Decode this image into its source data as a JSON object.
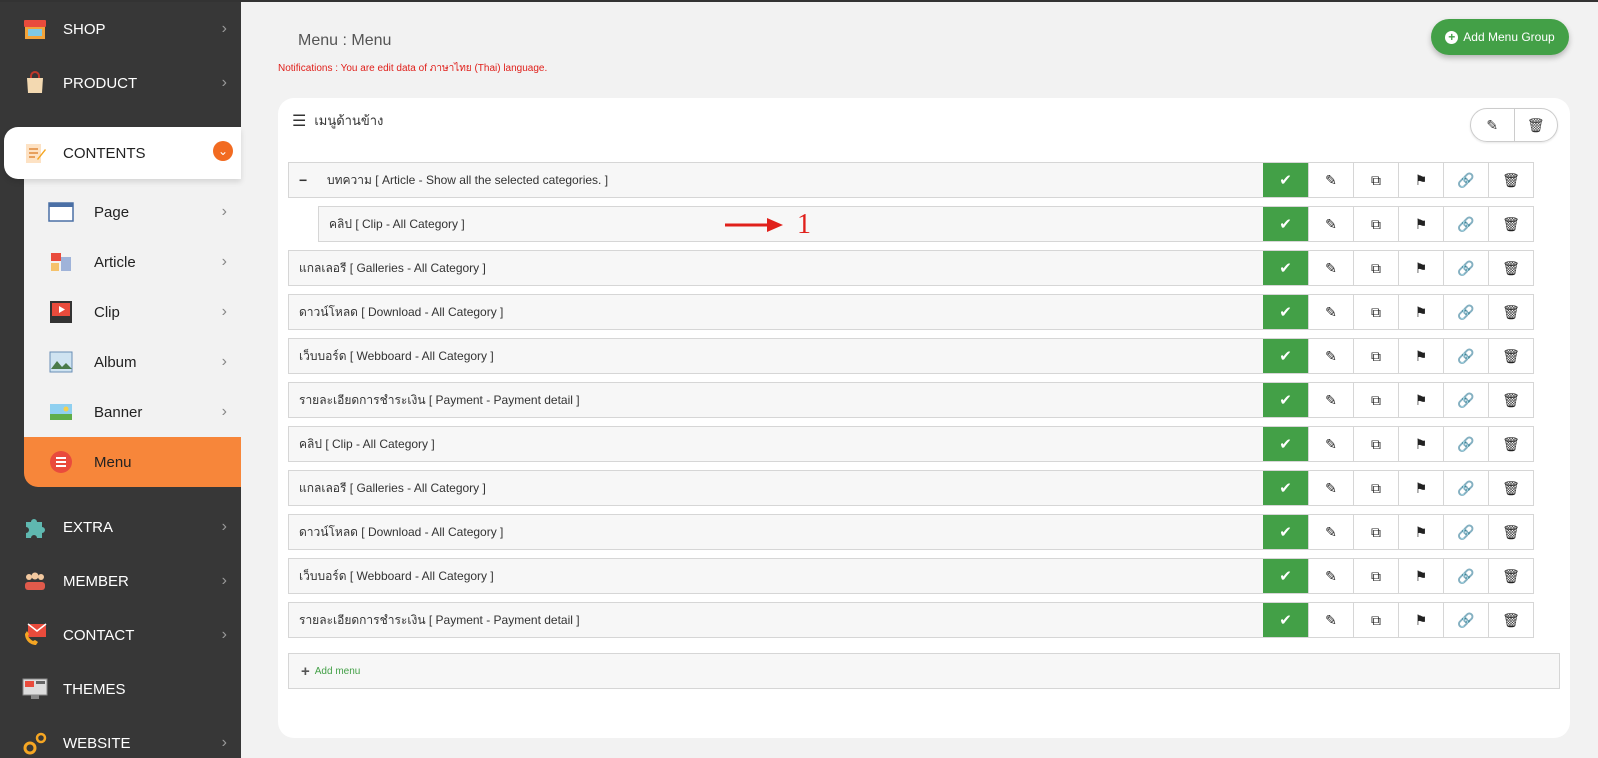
{
  "sidebar": {
    "top_items": [
      {
        "label": "SHOP",
        "icon": "shop-icon"
      },
      {
        "label": "PRODUCT",
        "icon": "product-bag-icon"
      }
    ],
    "contents": {
      "label": "CONTENTS",
      "icon": "contents-edit-icon",
      "sub_items": [
        {
          "label": "Page",
          "icon": "page-icon"
        },
        {
          "label": "Article",
          "icon": "article-icon"
        },
        {
          "label": "Clip",
          "icon": "clip-icon"
        },
        {
          "label": "Album",
          "icon": "album-icon"
        },
        {
          "label": "Banner",
          "icon": "banner-icon"
        },
        {
          "label": "Menu",
          "icon": "menu-list-icon",
          "active": true
        }
      ]
    },
    "bottom_items": [
      {
        "label": "EXTRA",
        "icon": "puzzle-icon"
      },
      {
        "label": "MEMBER",
        "icon": "member-icon"
      },
      {
        "label": "CONTACT",
        "icon": "contact-icon"
      },
      {
        "label": "THEMES",
        "icon": "themes-icon"
      },
      {
        "label": "WEBSITE",
        "icon": "website-gear-icon"
      }
    ]
  },
  "header": {
    "title": "Menu : Menu",
    "notification": "Notifications : You are edit data of ภาษาไทย (Thai) language.",
    "add_group_label": "Add Menu Group"
  },
  "menu_group": {
    "title": "เมนูด้านข้าง",
    "rows": [
      {
        "label": "บทความ [ Article - Show all the selected categories. ]",
        "toggle": "−"
      },
      {
        "label": "คลิป [ Clip - All Category ]",
        "child": true
      },
      {
        "label": "แกลเลอรี [ Galleries - All Category ]"
      },
      {
        "label": "ดาวน์โหลด [ Download - All Category ]"
      },
      {
        "label": "เว็บบอร์ด [ Webboard - All Category ]"
      },
      {
        "label": "รายละเอียดการชำระเงิน [ Payment - Payment detail ]"
      },
      {
        "label": "คลิป [ Clip - All Category ]"
      },
      {
        "label": "แกลเลอรี [ Galleries - All Category ]"
      },
      {
        "label": "ดาวน์โหลด [ Download - All Category ]"
      },
      {
        "label": "เว็บบอร์ด [ Webboard - All Category ]"
      },
      {
        "label": "รายละเอียดการชำระเงิน [ Payment - Payment detail ]"
      }
    ],
    "add_menu_label": "Add menu"
  },
  "annotation": {
    "number": "1"
  },
  "colors": {
    "accent": "#43a047",
    "sidebar": "#373737",
    "active": "#f7863a",
    "notice": "#e0201b"
  }
}
